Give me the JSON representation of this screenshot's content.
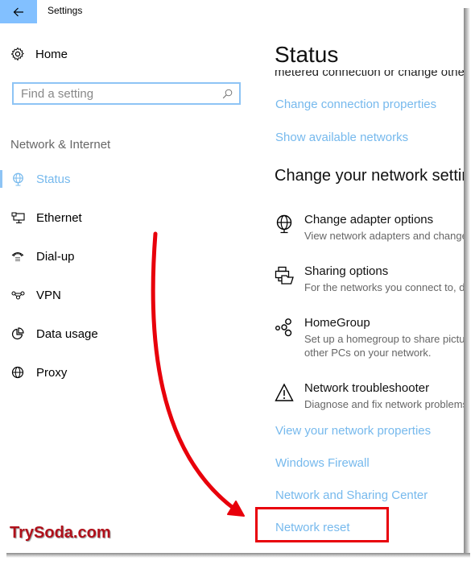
{
  "window": {
    "title": "Settings",
    "back_icon": "arrow-left-icon",
    "accent_color": "#82c0ff",
    "link_color": "#76b9ed"
  },
  "sidebar": {
    "home_label": "Home",
    "home_icon": "gear-icon",
    "search": {
      "placeholder": "Find a setting",
      "value": "",
      "icon": "search-icon"
    },
    "section_label": "Network & Internet",
    "items": [
      {
        "label": "Status",
        "icon": "globe-monitor-icon",
        "active": true
      },
      {
        "label": "Ethernet",
        "icon": "ethernet-icon",
        "active": false
      },
      {
        "label": "Dial-up",
        "icon": "phone-icon",
        "active": false
      },
      {
        "label": "VPN",
        "icon": "vpn-icon",
        "active": false
      },
      {
        "label": "Data usage",
        "icon": "pie-chart-icon",
        "active": false
      },
      {
        "label": "Proxy",
        "icon": "globe-icon",
        "active": false
      }
    ]
  },
  "main": {
    "title": "Status",
    "clipped_text": "metered connection or change other",
    "top_links": [
      "Change connection properties",
      "Show available networks"
    ],
    "subheading": "Change your network settings",
    "options": [
      {
        "title": "Change adapter options",
        "description": "View network adapters and change connection settings.",
        "icon": "globe-monitor-icon"
      },
      {
        "title": "Sharing options",
        "description": "For the networks you connect to, decide what you want to share.",
        "icon": "printer-folder-icon"
      },
      {
        "title": "HomeGroup",
        "description": "Set up a homegroup to share pictures, music, files and printers with other PCs on your network.",
        "description_line1": "Set up a homegroup to share pictu",
        "description_line2": "other PCs on your network.",
        "icon": "homegroup-icon"
      },
      {
        "title": "Network troubleshooter",
        "description": "Diagnose and fix network problems.",
        "icon": "warning-icon"
      }
    ],
    "bottom_links": [
      "View your network properties",
      "Windows Firewall",
      "Network and Sharing Center",
      "Network reset"
    ]
  },
  "annotation": {
    "highlighted_item": "Network reset",
    "highlight_color": "#e8000b",
    "watermark": "TrySoda.com"
  }
}
